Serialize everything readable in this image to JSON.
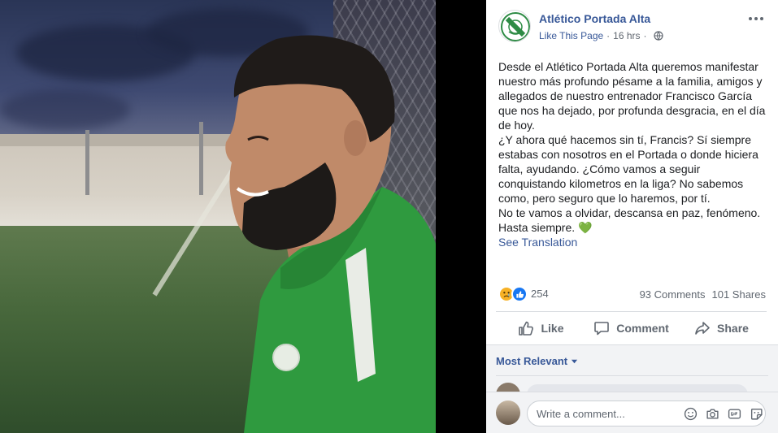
{
  "page": {
    "name": "Atlético Portada Alta",
    "like_page": "Like This Page",
    "time": "16 hrs",
    "separator": "·"
  },
  "post": {
    "paragraph1": "Desde el Atlético Portada Alta queremos manifestar nuestro más profundo pésame a la familia, amigos y allegados de nuestro entrenador Francisco García que nos ha dejado, por profunda desgracia, en el día de hoy.",
    "paragraph2": "¿Y ahora qué hacemos sin tí, Francis? Sí siempre estabas con nosotros en el Portada o donde hiciera falta, ayudando. ¿Cómo vamos a seguir conquistando kilometros en la liga? No sabemos como, pero seguro que lo haremos, por tí.",
    "paragraph3": "No te vamos a olvidar, descansa en paz, fenómeno. Hasta siempre.",
    "heart": "💚",
    "see_translation": "See Translation"
  },
  "stats": {
    "reactions": "254",
    "comments": "93 Comments",
    "shares": "101 Shares"
  },
  "actions": {
    "like": "Like",
    "comment": "Comment",
    "share": "Share"
  },
  "comments": {
    "sort_label": "Most Relevant",
    "composer_placeholder": "Write a comment..."
  },
  "colors": {
    "link": "#385898",
    "brand_green": "#2e8b45",
    "like_blue": "#1877f2",
    "sad_yellow": "#f7b125"
  },
  "icons": {
    "privacy": "globe-icon",
    "more": "more-horizontal-icon",
    "like": "thumbs-up-icon",
    "comment": "speech-bubble-icon",
    "share": "share-arrow-icon",
    "sort": "caret-down-icon",
    "emoji": "smiley-icon",
    "camera": "camera-icon",
    "gif": "gif-icon",
    "sticker": "sticker-icon"
  }
}
